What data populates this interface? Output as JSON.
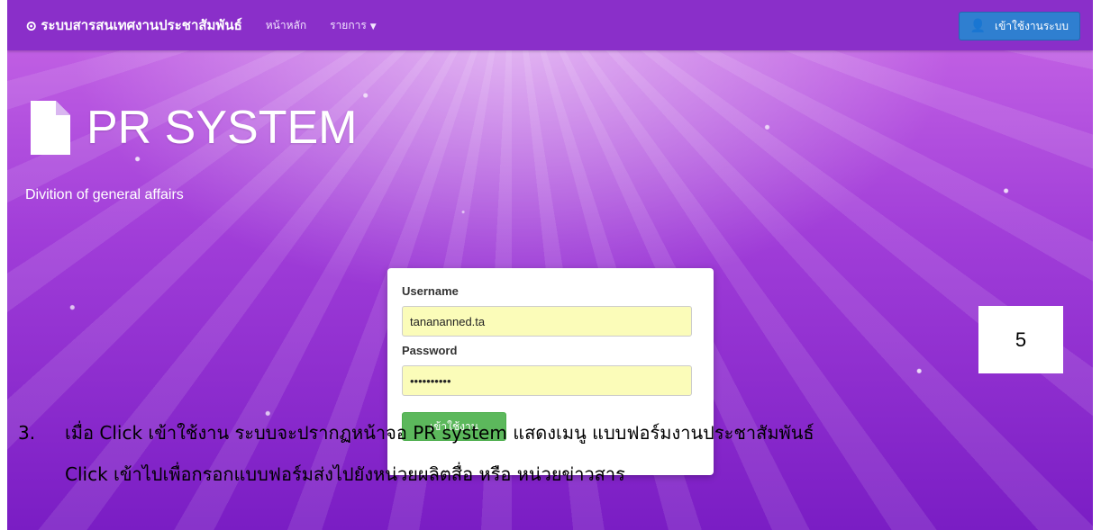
{
  "navbar": {
    "brand": "ระบบสารสนเทศงานประชาสัมพันธ์",
    "brand_icon": "circle-icon",
    "links": [
      {
        "label": "หน้าหลัก"
      },
      {
        "label": "รายการ",
        "has_dropdown": true
      }
    ],
    "login_button": "เข้าใช้งานระบบ",
    "bg_color": "#8a2fc9",
    "login_button_color": "#2f7fd0"
  },
  "hero": {
    "title": "PR SYSTEM",
    "subtitle": "Divition of general affairs",
    "icon": "document-icon"
  },
  "login_form": {
    "username_label": "Username",
    "username_value": "tanananned.ta",
    "password_label": "Password",
    "password_value": "••••••••••",
    "submit_label": "เข้าใช้งาน",
    "submit_color": "#5cb85c",
    "input_bg_color": "#fbfcb9"
  },
  "page_number": "5",
  "caption": {
    "number": "3.",
    "line1": "เมื่อ Click เข้าใช้งาน ระบบจะปรากฏหน้าจอ PR system แสดงเมนู แบบฟอร์มงานประชาสัมพันธ์",
    "line2": "Click เข้าไปเพื่อกรอกแบบฟอร์มส่งไปยังหน่วยผลิตสื่อ หรือ หน่วยข่าวสาร"
  }
}
